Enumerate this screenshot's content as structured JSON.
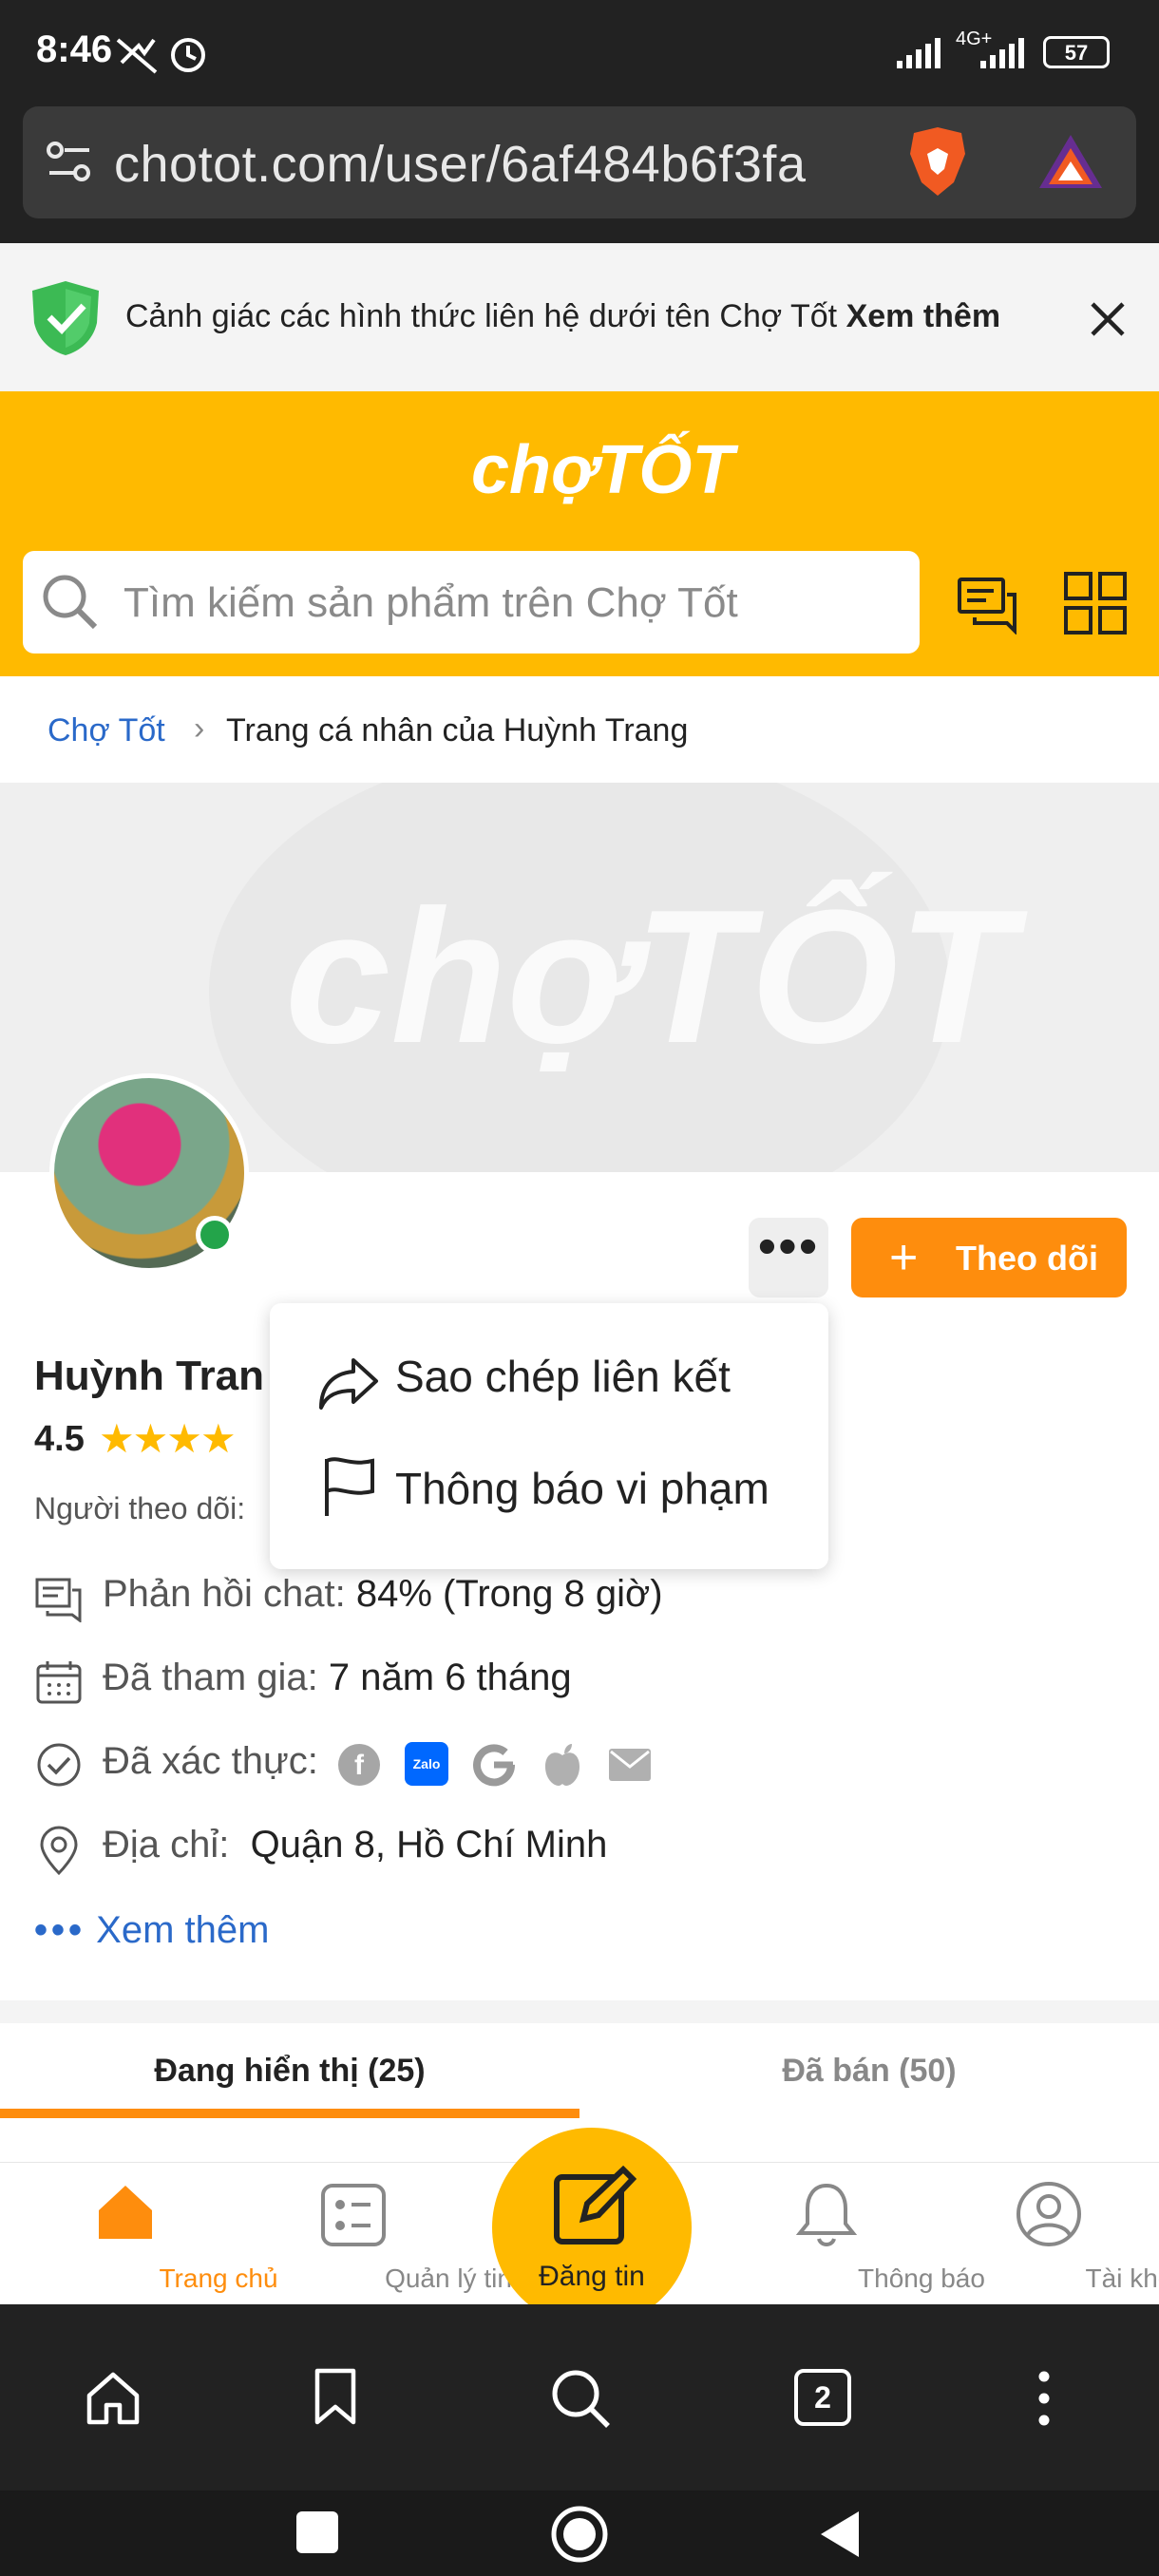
{
  "status": {
    "time": "8:46",
    "network": "4G+",
    "battery": "57"
  },
  "browser": {
    "url": "chotot.com/user/6af484b6f3fa"
  },
  "warning": {
    "text": "Cảnh giác các hình thức liên hệ dưới tên Chợ Tốt",
    "link": "Xem thêm"
  },
  "header": {
    "logo": "chợTỐT",
    "search_placeholder": "Tìm kiếm sản phẩm trên Chợ Tốt"
  },
  "breadcrumb": {
    "home": "Chợ Tốt",
    "separator": "›",
    "current": "Trang cá nhân của Huỳnh Trang"
  },
  "cover": {
    "watermark": "chợTỐT"
  },
  "actions": {
    "more": "•••",
    "follow": "Theo dõi"
  },
  "profile": {
    "name": "Huỳnh Tran",
    "rating": "4.5",
    "followers_label": "Người theo dõi:",
    "chat_label": "Phản hồi chat:",
    "chat_value": "84% (Trong 8 giờ)",
    "joined_label": "Đã tham gia:",
    "joined_value": "7 năm 6 tháng",
    "verified_label": "Đã xác thực:",
    "address_label": "Địa chỉ:",
    "address_value": "Quận 8, Hồ Chí Minh",
    "see_more": "Xem thêm"
  },
  "menu": {
    "copy_link": "Sao chép liên kết",
    "report": "Thông báo vi phạm"
  },
  "tabs": {
    "showing": "Đang hiển thị (25)",
    "sold": "Đã bán (50)"
  },
  "bottom_nav": {
    "home": "Trang chủ",
    "manage": "Quản lý tin",
    "post": "Đăng tin",
    "notifications": "Thông báo",
    "account": "Tài khoản"
  },
  "browser_nav": {
    "tabs_count": "2"
  },
  "colors": {
    "brand": "#ffba00",
    "accent": "#fe8d0d",
    "link": "#2a69c9",
    "online": "#23a44a"
  }
}
